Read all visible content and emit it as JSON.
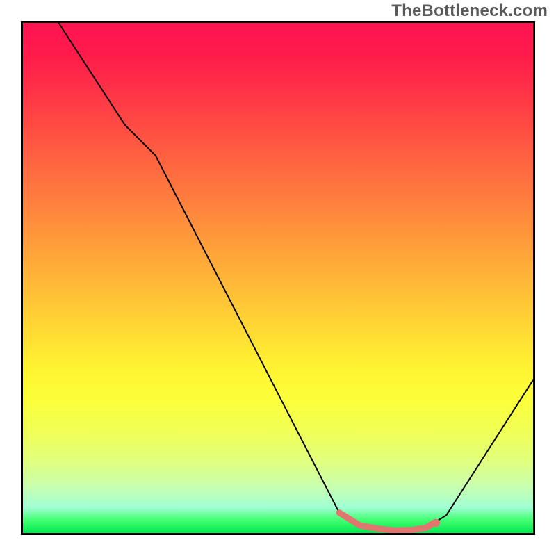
{
  "watermark": "TheBottleneck.com",
  "chart_data": {
    "type": "line",
    "title": "",
    "xlabel": "",
    "ylabel": "",
    "xlim": [
      0,
      100
    ],
    "ylim": [
      0,
      100
    ],
    "grid": false,
    "series": [
      {
        "name": "bottleneck-curve",
        "x": [
          7,
          20,
          26,
          62,
          66,
          70,
          73,
          76,
          79,
          83,
          100
        ],
        "y": [
          100,
          80,
          74,
          4,
          1.5,
          0.8,
          0.5,
          0.6,
          1,
          3.5,
          30
        ],
        "color": "#000000",
        "width": 2
      },
      {
        "name": "highlight-segment",
        "x": [
          62,
          66,
          70,
          73,
          76,
          79,
          80.5
        ],
        "y": [
          4,
          1.5,
          0.8,
          0.5,
          0.6,
          1,
          2
        ],
        "color": "#e0766f",
        "width": 9,
        "markers": [
          {
            "x": 79.5,
            "y": 1.3,
            "r": 4.5
          },
          {
            "x": 81,
            "y": 2.0,
            "r": 5.5
          }
        ]
      }
    ],
    "background_gradient": {
      "stops": [
        {
          "pos": 0,
          "color": "#ff1450"
        },
        {
          "pos": 0.5,
          "color": "#ffd934"
        },
        {
          "pos": 0.97,
          "color": "#40ff70"
        },
        {
          "pos": 1.0,
          "color": "#00e850"
        }
      ]
    }
  }
}
